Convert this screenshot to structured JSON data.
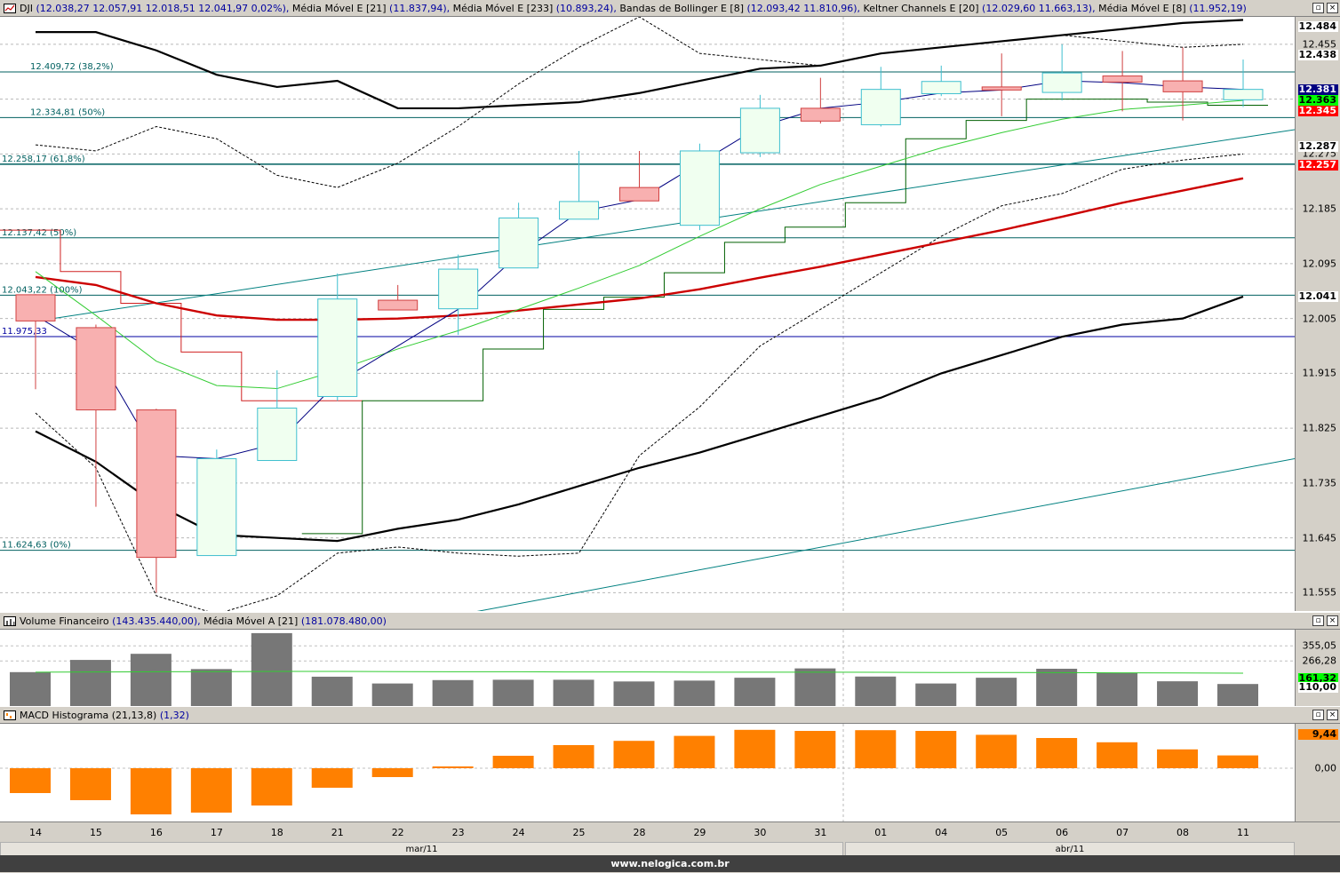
{
  "main_panel": {
    "symbol": "DJI",
    "ohlc_text": "(12.038,27  12.057,91  12.018,51  12.041,97  0,02%)",
    "indicators": [
      {
        "name": "Média Móvel E [21]",
        "value": "(11.837,94)"
      },
      {
        "name": "Média Móvel E [233]",
        "value": "(10.893,24)"
      },
      {
        "name": "Bandas de Bollinger E [8]",
        "value": "(12.093,42  11.810,96)"
      },
      {
        "name": "Keltner Channels E [20]",
        "value": "(12.029,60  11.663,13)"
      },
      {
        "name": "Média Móvel E [8]",
        "value": "(11.952,19)"
      }
    ],
    "y_ticks": [
      "12.455",
      "12.365",
      "12.275",
      "12.185",
      "12.095",
      "12.005",
      "11.915",
      "11.825",
      "11.735",
      "11.645",
      "11.555"
    ],
    "price_tags": [
      {
        "value": "12.484",
        "bg": "#ffffff",
        "color": "#000000"
      },
      {
        "value": "12.438",
        "bg": "#ffffff",
        "color": "#000000"
      },
      {
        "value": "12.381",
        "bg": "#000080",
        "color": "#ffffff"
      },
      {
        "value": "12.363",
        "bg": "#00ff00",
        "color": "#000000"
      },
      {
        "value": "12.345",
        "bg": "#ff0000",
        "color": "#ffffff"
      },
      {
        "value": "12.287",
        "bg": "#ffffff",
        "color": "#000000"
      },
      {
        "value": "12.257",
        "bg": "#ff0000",
        "color": "#ffffff"
      },
      {
        "value": "12.041",
        "bg": "#ffffff",
        "color": "#000000"
      }
    ],
    "fib_labels": [
      "12.409,72 (38,2%)",
      "12.334,81 (50%)",
      "12.258,17 (61,8%)",
      "12.137,42 (50%)",
      "12.043,22 (100%)",
      "11.975,33",
      "11.624,63 (0%)"
    ]
  },
  "volume_panel": {
    "title": "Volume Financeiro",
    "value": "(143.435.440,00)",
    "ma_name": "Média Móvel A [21]",
    "ma_value": "(181.078.480,00)",
    "y_ticks": [
      "355,05",
      "266,28"
    ],
    "tags": [
      {
        "value": "161,32",
        "bg": "#00ff00",
        "color": "#000000"
      },
      {
        "value": "110,00",
        "bg": "#ffffff",
        "color": "#000000"
      }
    ]
  },
  "macd_panel": {
    "title": "MACD Histograma (21,13,8)",
    "value": "(1,32)",
    "y_ticks": [
      "0,00"
    ],
    "tags": [
      {
        "value": "9,44",
        "bg": "#ff8000",
        "color": "#000000"
      }
    ]
  },
  "x_axis": {
    "days": [
      "14",
      "15",
      "16",
      "17",
      "18",
      "21",
      "22",
      "23",
      "24",
      "25",
      "28",
      "29",
      "30",
      "31",
      "01",
      "04",
      "05",
      "06",
      "07",
      "08",
      "11"
    ],
    "months": [
      "mar/11",
      "abr/11"
    ]
  },
  "footer": "www.nelogica.com.br",
  "colors": {
    "up_fill": "#f0fff0",
    "up_border": "#3fbfcf",
    "down_fill": "#f8b0b0",
    "down_border": "#d04040",
    "volume": "#777777",
    "macd": "#ff8000",
    "ma21": "#cc0000",
    "ma233": "#000000",
    "ma8": "#33cc33",
    "keltner": "#000000",
    "bollinger": "#000000",
    "fib": "#006060",
    "trend": "#008080"
  },
  "chart_data": [
    {
      "type": "candlestick",
      "title": "DJI",
      "x": [
        "14",
        "15",
        "16",
        "17",
        "18",
        "21",
        "22",
        "23",
        "24",
        "25",
        "28",
        "29",
        "30",
        "31",
        "01",
        "04",
        "05",
        "06",
        "07",
        "08",
        "11"
      ],
      "open": [
        12044,
        11990,
        11855,
        11616,
        11772,
        11877,
        12035,
        12021,
        12088,
        12168,
        12220,
        12158,
        12277,
        12350,
        12323,
        12374,
        12385,
        12376,
        12403,
        12395,
        12364
      ],
      "high": [
        12045,
        11995,
        11857,
        11790,
        11920,
        12079,
        12060,
        12110,
        12195,
        12280,
        12280,
        12292,
        12372,
        12400,
        12418,
        12420,
        12440,
        12455,
        12444,
        12450,
        12430
      ],
      "low": [
        11889,
        11696,
        11555,
        11616,
        11778,
        11870,
        12022,
        11978,
        12088,
        12168,
        12205,
        12150,
        12270,
        12325,
        12320,
        12370,
        12337,
        12363,
        12345,
        12330,
        12352
      ],
      "close": [
        12001,
        11855,
        11613,
        11775,
        11858,
        12037,
        12019,
        12086,
        12170,
        12197,
        12198,
        12280,
        12350,
        12329,
        12381,
        12394,
        12380,
        12408,
        12393,
        12377,
        12381
      ],
      "ylim": [
        11525,
        12500
      ]
    },
    {
      "type": "bar",
      "title": "Volume Financeiro",
      "x": [
        "14",
        "15",
        "16",
        "17",
        "18",
        "21",
        "22",
        "23",
        "24",
        "25",
        "28",
        "29",
        "30",
        "31",
        "01",
        "04",
        "05",
        "06",
        "07",
        "08",
        "11"
      ],
      "values": [
        200,
        272,
        308,
        218,
        430,
        173,
        133,
        153,
        155,
        155,
        145,
        150,
        167,
        222,
        174,
        133,
        167,
        220,
        195,
        146,
        130
      ],
      "series": [
        {
          "name": "Média Móvel A [21]",
          "values": [
            200,
            201,
            202,
            203,
            204,
            204,
            203,
            202,
            202,
            201,
            201,
            200,
            200,
            200,
            199,
            198,
            198,
            197,
            196,
            195,
            194
          ]
        }
      ],
      "ylim": [
        0,
        440
      ]
    },
    {
      "type": "bar",
      "title": "MACD Histograma (21,13,8)",
      "x": [
        "14",
        "15",
        "16",
        "17",
        "18",
        "21",
        "22",
        "23",
        "24",
        "25",
        "28",
        "29",
        "30",
        "31",
        "01",
        "04",
        "05",
        "06",
        "07",
        "08",
        "11"
      ],
      "values": [
        -7,
        -9,
        -13,
        -12.5,
        -10.5,
        -5.5,
        -2.5,
        0.5,
        3.5,
        6.5,
        7.7,
        9.1,
        10.8,
        10.5,
        10.7,
        10.5,
        9.4,
        8.5,
        7.3,
        5.3,
        3.6
      ],
      "ylim": [
        -15,
        12.5
      ]
    }
  ]
}
